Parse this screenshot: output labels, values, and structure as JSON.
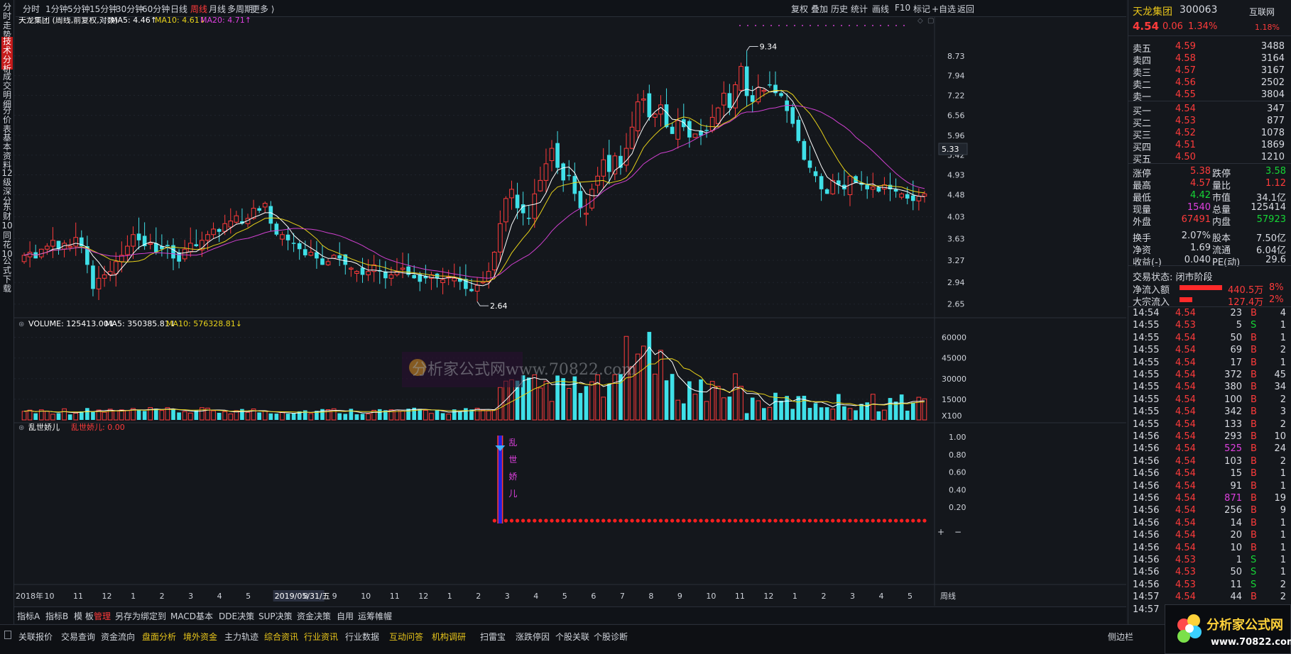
{
  "topbar": {
    "left": [
      {
        "label": "分时",
        "active": false
      },
      {
        "label": "1分钟",
        "active": false
      },
      {
        "label": "5分钟",
        "active": false
      },
      {
        "label": "15分钟",
        "active": false
      },
      {
        "label": "30分钟",
        "active": false
      },
      {
        "label": "60分钟",
        "active": false
      },
      {
        "label": "日线",
        "active": false
      },
      {
        "label": "周线",
        "active": true
      },
      {
        "label": "月线",
        "active": false
      },
      {
        "label": "多周期",
        "active": false
      },
      {
        "label": "更多 ⟩",
        "active": false
      }
    ],
    "right": [
      "复权",
      "叠加",
      "历史",
      "统计",
      "画线",
      "F10",
      "标记",
      "+自选",
      "返回"
    ]
  },
  "left_strip": [
    "分时走势",
    "技术分析",
    "成交明细",
    "分价表",
    "基本资料",
    "12级深分",
    "东财10",
    "同花10",
    "公式下载"
  ],
  "main_chart": {
    "title": "天龙集团 (周线,前复权,对数)",
    "ma5": "MA5: 4.46↑",
    "ma10": "MA10: 4.61↓",
    "ma20": "MA20: 4.71↑",
    "high_label": "9.34",
    "low_label": "2.64",
    "current_price_tag": "5.33",
    "y_ticks": [
      "8.73",
      "7.94",
      "7.22",
      "6.56",
      "5.96",
      "5.42",
      "4.93",
      "4.48",
      "4.03",
      "3.63",
      "3.27",
      "2.94",
      "2.65"
    ]
  },
  "volume_panel": {
    "vol": "VOLUME: 125413.00↓",
    "ma5": "MA5: 350385.81↓",
    "ma10": "MA10: 576328.81↓",
    "y_ticks": [
      "60000",
      "45000",
      "30000",
      "15000"
    ],
    "unit": "X100",
    "watermark": "分析家公式网www.70822.com"
  },
  "indicator_panel": {
    "name": "乱世娇儿",
    "value": "乱世娇儿: 0.00",
    "signal_text": "乱世娇儿",
    "y_ticks": [
      "1.00",
      "0.80",
      "0.60",
      "0.40",
      "0.20"
    ]
  },
  "x_axis": {
    "labels": [
      "2018年",
      "10",
      "11",
      "12",
      "1",
      "2",
      "3",
      "4",
      "5",
      "2019/05/31/五",
      "8",
      "9",
      "10",
      "11",
      "12",
      "1",
      "2",
      "3",
      "4",
      "5",
      "6",
      "7",
      "8",
      "9",
      "10",
      "11",
      "12",
      "1",
      "2",
      "3",
      "4",
      "5"
    ],
    "period": "周线"
  },
  "bottom_tabs1": [
    "指标A",
    "指标B",
    "模 板",
    "管理",
    "另存为",
    "绑定到",
    "MACD基本",
    "DDE决策",
    "SUP决策",
    "资金决策",
    "自用",
    "运筹帷幄"
  ],
  "bottom_tabs2": [
    "关联报价",
    "交易查询",
    "资金流向",
    "盘面分析",
    "境外资金",
    "主力轨迹",
    "综合资讯",
    "行业资讯",
    "行业数据",
    "互动问答",
    "机构调研",
    "扫雷宝",
    "涨跌停因",
    "个股关联",
    "个股诊断",
    "侧边栏"
  ],
  "quote": {
    "name": "天龙集团",
    "code": "300063",
    "source": "互联网",
    "price": "4.54",
    "change": "0.06",
    "pct": "1.34%",
    "ratio": "1.18%",
    "asks": [
      [
        "卖五",
        "4.59",
        "3488"
      ],
      [
        "卖四",
        "4.58",
        "3164"
      ],
      [
        "卖三",
        "4.57",
        "3167"
      ],
      [
        "卖二",
        "4.56",
        "2502"
      ],
      [
        "卖一",
        "4.55",
        "3804"
      ]
    ],
    "bids": [
      [
        "买一",
        "4.54",
        "347"
      ],
      [
        "买二",
        "4.53",
        "877"
      ],
      [
        "买三",
        "4.52",
        "1078"
      ],
      [
        "买四",
        "4.51",
        "1869"
      ],
      [
        "买五",
        "4.50",
        "1210"
      ]
    ],
    "stats": [
      [
        "涨停",
        "5.38",
        "跌停",
        "3.58"
      ],
      [
        "最高",
        "4.57",
        "量比",
        "1.12"
      ],
      [
        "最低",
        "4.42",
        "市值",
        "34.1亿"
      ],
      [
        "现量",
        "1540",
        "总量",
        "125414"
      ],
      [
        "外盘",
        "67491",
        "内盘",
        "57923"
      ],
      [
        "换手",
        "2.07%",
        "股本",
        "7.50亿"
      ],
      [
        "净资",
        "1.69",
        "流通",
        "6.04亿"
      ],
      [
        "收益(-)",
        "0.040",
        "PE(动)",
        "29.6"
      ]
    ],
    "trade_status": "交易状态: 闭市阶段",
    "flows": [
      [
        "净流入额",
        "440.5万",
        "8%"
      ],
      [
        "大宗流入",
        "127.4万",
        "2%"
      ]
    ],
    "ticks": [
      [
        "14:54",
        "4.54",
        "23",
        "B",
        "4"
      ],
      [
        "14:55",
        "4.53",
        "5",
        "S",
        "1"
      ],
      [
        "14:55",
        "4.54",
        "50",
        "B",
        "1"
      ],
      [
        "14:55",
        "4.54",
        "69",
        "B",
        "2"
      ],
      [
        "14:55",
        "4.54",
        "17",
        "B",
        "1"
      ],
      [
        "14:55",
        "4.54",
        "372",
        "B",
        "45"
      ],
      [
        "14:55",
        "4.54",
        "380",
        "B",
        "34"
      ],
      [
        "14:55",
        "4.54",
        "100",
        "B",
        "2"
      ],
      [
        "14:55",
        "4.54",
        "342",
        "B",
        "3"
      ],
      [
        "14:55",
        "4.54",
        "133",
        "B",
        "2"
      ],
      [
        "14:56",
        "4.54",
        "293",
        "B",
        "10"
      ],
      [
        "14:56",
        "4.54",
        "525",
        "B",
        "24"
      ],
      [
        "14:56",
        "4.54",
        "103",
        "B",
        "2"
      ],
      [
        "14:56",
        "4.54",
        "15",
        "B",
        "1"
      ],
      [
        "14:56",
        "4.54",
        "91",
        "B",
        "1"
      ],
      [
        "14:56",
        "4.54",
        "871",
        "B",
        "19"
      ],
      [
        "14:56",
        "4.54",
        "256",
        "B",
        "9"
      ],
      [
        "14:56",
        "4.54",
        "14",
        "B",
        "1"
      ],
      [
        "14:56",
        "4.54",
        "20",
        "B",
        "1"
      ],
      [
        "14:56",
        "4.54",
        "10",
        "B",
        "1"
      ],
      [
        "14:56",
        "4.53",
        "1",
        "S",
        "1"
      ],
      [
        "14:56",
        "4.53",
        "50",
        "S",
        "1"
      ],
      [
        "14:56",
        "4.53",
        "11",
        "S",
        "2"
      ],
      [
        "14:57",
        "4.54",
        "44",
        "B",
        "2"
      ],
      [
        "14:57",
        "4.54",
        "31",
        "B",
        "1"
      ]
    ]
  },
  "brand_logo": {
    "title": "分析家公式网",
    "url": "www.70822.com"
  },
  "colors": {
    "up": "#ff3b3b",
    "down": "#3fe0e8",
    "ma5": "#ffffff",
    "ma10": "#e8d21a",
    "ma20": "#d040d0",
    "bg": "#14171c"
  }
}
